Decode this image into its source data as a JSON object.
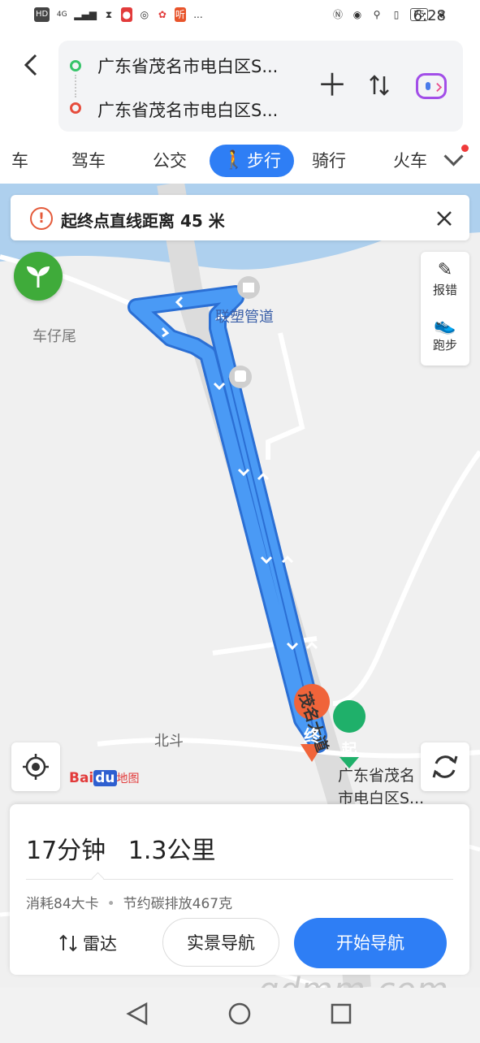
{
  "status_bar": {
    "left_icons": [
      "HD",
      "4G",
      "signal",
      "hourglass",
      "mic",
      "wechat",
      "huawei",
      "tingting",
      "..."
    ],
    "battery": "75",
    "time": "6:28"
  },
  "header": {
    "start_place": "广东省茂名市电白区S...",
    "end_place": "广东省茂名市电白区S..."
  },
  "tabs": [
    {
      "label": "车"
    },
    {
      "label": "驾车"
    },
    {
      "label": "公交"
    },
    {
      "label": "步行",
      "selected": true
    },
    {
      "label": "骑行"
    },
    {
      "label": "火车"
    }
  ],
  "alert": {
    "text": "起终点直线距离 45 米"
  },
  "side_tools": {
    "report_label": "报错",
    "run_label": "跑步"
  },
  "map": {
    "labels": {
      "village1": "车仔尾",
      "poi1": "联塑管道",
      "village2": "北斗",
      "road": "茂名大道",
      "start_place_line1": "广东省茂名",
      "start_place_line2": "市电白区S..."
    },
    "end_marker": "终",
    "start_marker": "起",
    "logo": "Bai地图",
    "logo_parts": {
      "bai": "Bai",
      "du": "du",
      "suffix": "地图"
    },
    "route_color": "#3d8ff0"
  },
  "summary": {
    "duration": "17分钟",
    "distance": "1.3公里",
    "calories": "消耗84大卡",
    "separator": "•",
    "carbon": "节约碳排放467克",
    "radar_label": "雷达",
    "ar_label": "实景导航",
    "start_label": "开始导航"
  },
  "watermark": "gdmm.com"
}
